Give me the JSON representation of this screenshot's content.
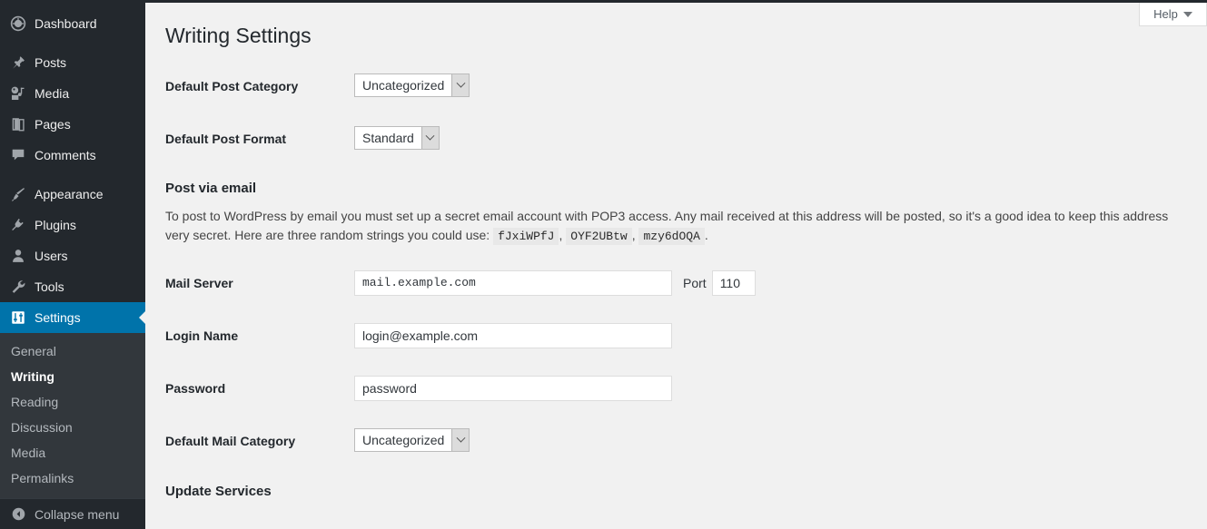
{
  "sidebar": {
    "items": [
      {
        "label": "Dashboard",
        "icon": "dashboard-icon",
        "name": "dashboard"
      },
      {
        "label": "Posts",
        "icon": "pin-icon",
        "name": "posts"
      },
      {
        "label": "Media",
        "icon": "media-icon",
        "name": "media"
      },
      {
        "label": "Pages",
        "icon": "pages-icon",
        "name": "pages"
      },
      {
        "label": "Comments",
        "icon": "comments-icon",
        "name": "comments"
      },
      {
        "label": "Appearance",
        "icon": "brush-icon",
        "name": "appearance"
      },
      {
        "label": "Plugins",
        "icon": "plugin-icon",
        "name": "plugins"
      },
      {
        "label": "Users",
        "icon": "user-icon",
        "name": "users"
      },
      {
        "label": "Tools",
        "icon": "wrench-icon",
        "name": "tools"
      },
      {
        "label": "Settings",
        "icon": "sliders-icon",
        "name": "settings",
        "current": true
      }
    ],
    "submenu": [
      {
        "label": "General",
        "current": false
      },
      {
        "label": "Writing",
        "current": true
      },
      {
        "label": "Reading",
        "current": false
      },
      {
        "label": "Discussion",
        "current": false
      },
      {
        "label": "Media",
        "current": false
      },
      {
        "label": "Permalinks",
        "current": false
      }
    ],
    "collapse_label": "Collapse menu",
    "collapse_icon": "collapse-arrow-icon",
    "colors": {
      "background": "#23282d",
      "submenu_background": "#32373c",
      "current": "#0073aa"
    }
  },
  "header": {
    "help_label": "Help",
    "help_icon": "caret-down-icon"
  },
  "page": {
    "title": "Writing Settings"
  },
  "fields": {
    "default_post_category": {
      "label": "Default Post Category",
      "value": "Uncategorized"
    },
    "default_post_format": {
      "label": "Default Post Format",
      "value": "Standard"
    },
    "mail_server": {
      "label": "Mail Server",
      "value": "mail.example.com"
    },
    "port": {
      "label": "Port",
      "value": "110"
    },
    "login_name": {
      "label": "Login Name",
      "value": "login@example.com"
    },
    "password": {
      "label": "Password",
      "value": "password"
    },
    "default_mail_category": {
      "label": "Default Mail Category",
      "value": "Uncategorized"
    }
  },
  "sections": {
    "post_via_email": {
      "heading": "Post via email",
      "description_part1": "To post to WordPress by email you must set up a secret email account with POP3 access. Any mail received at this address will be posted, so it's a good idea to keep this address very secret. Here are three random strings you could use:",
      "random_strings": [
        "fJxiWPfJ",
        "OYF2UBtw",
        "mzy6dOQA"
      ],
      "description_end": "."
    },
    "update_services": {
      "heading": "Update Services"
    }
  }
}
